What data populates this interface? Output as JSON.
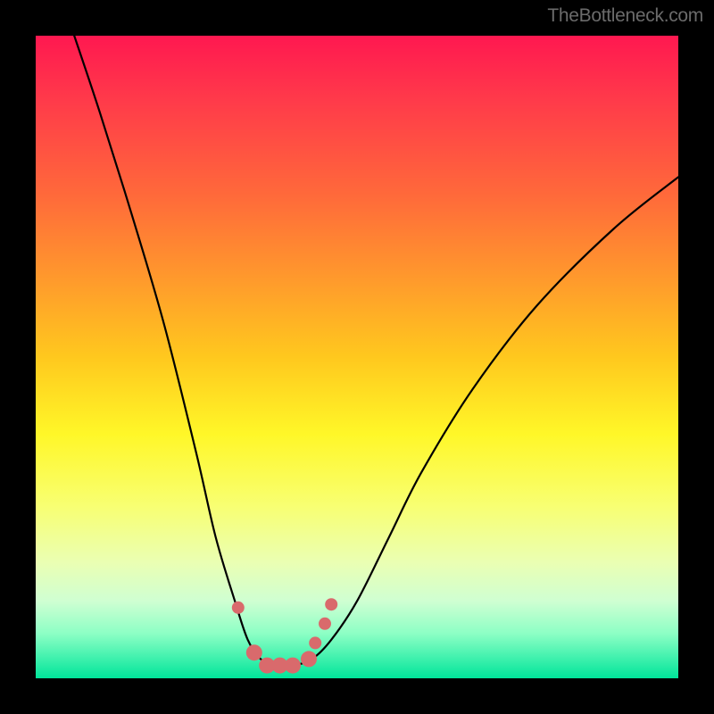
{
  "watermark": "TheBottleneck.com",
  "chart_data": {
    "type": "line",
    "title": "",
    "xlabel": "",
    "ylabel": "",
    "xlim": [
      0,
      100
    ],
    "ylim": [
      0,
      100
    ],
    "grid": false,
    "series": [
      {
        "name": "bottleneck-curve",
        "x": [
          6,
          10,
          15,
          20,
          25,
          28,
          31,
          33,
          35,
          37,
          40,
          43,
          46,
          50,
          55,
          60,
          68,
          78,
          90,
          100
        ],
        "values": [
          100,
          88,
          72,
          55,
          35,
          22,
          12,
          6,
          3,
          2,
          2,
          3,
          6,
          12,
          22,
          32,
          45,
          58,
          70,
          78
        ]
      }
    ],
    "annotations": {
      "markers": {
        "name": "highlight-markers",
        "x": [
          31.5,
          34,
          36,
          38,
          40,
          42.5,
          43.5,
          45,
          46
        ],
        "values": [
          11,
          4,
          2,
          2,
          2,
          3,
          5.5,
          8.5,
          11.5
        ],
        "size": [
          7,
          9,
          9,
          9,
          9,
          9,
          7,
          7,
          7
        ],
        "color": "#d96a6c"
      }
    },
    "background_gradient": {
      "direction": "top-to-bottom",
      "stops": [
        {
          "pos": 0.0,
          "color": "#ff1850"
        },
        {
          "pos": 0.1,
          "color": "#ff3a4a"
        },
        {
          "pos": 0.25,
          "color": "#ff6a3a"
        },
        {
          "pos": 0.38,
          "color": "#ff9a2c"
        },
        {
          "pos": 0.5,
          "color": "#ffc81e"
        },
        {
          "pos": 0.62,
          "color": "#fff728"
        },
        {
          "pos": 0.73,
          "color": "#f8ff71"
        },
        {
          "pos": 0.82,
          "color": "#eaffb3"
        },
        {
          "pos": 0.88,
          "color": "#cfffd2"
        },
        {
          "pos": 0.93,
          "color": "#8dffc5"
        },
        {
          "pos": 1.0,
          "color": "#00e59a"
        }
      ]
    }
  }
}
